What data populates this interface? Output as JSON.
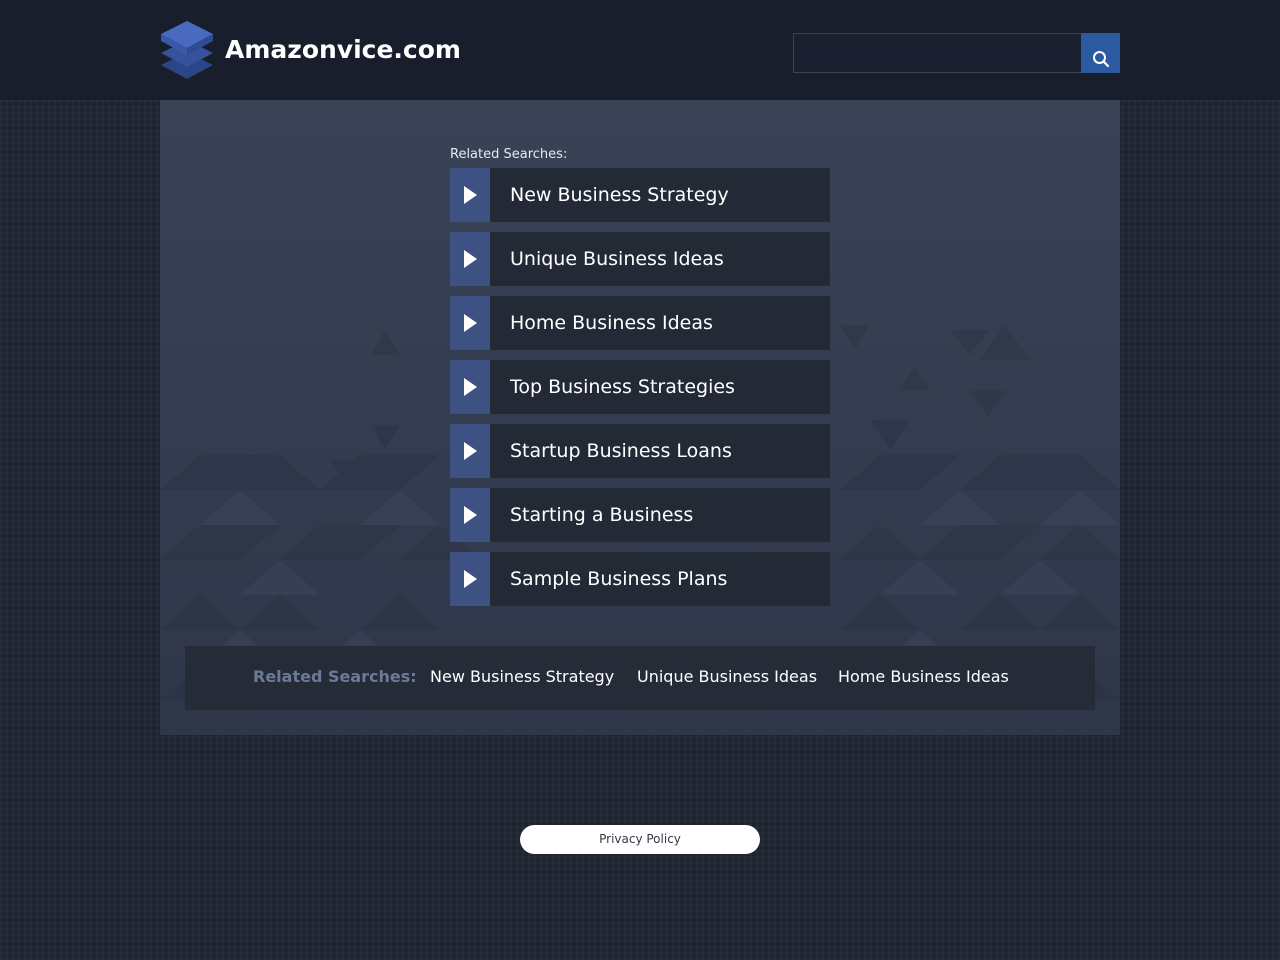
{
  "header": {
    "site_title": "Amazonvice.com",
    "logo_icon": "stacked-layers-icon",
    "search": {
      "placeholder": "",
      "value": "",
      "button_icon": "search-icon"
    }
  },
  "main": {
    "related_heading": "Related Searches:",
    "arrow_icon": "play-arrow-icon",
    "links": [
      {
        "label": "New Business Strategy"
      },
      {
        "label": "Unique Business Ideas"
      },
      {
        "label": "Home Business Ideas"
      },
      {
        "label": "Top Business Strategies"
      },
      {
        "label": "Startup Business Loans"
      },
      {
        "label": "Starting a Business"
      },
      {
        "label": "Sample Business Plans"
      }
    ]
  },
  "bottom_bar": {
    "label": "Related Searches:",
    "links": [
      {
        "label": "New Business Strategy"
      },
      {
        "label": "Unique Business Ideas"
      },
      {
        "label": "Home Business Ideas"
      }
    ]
  },
  "footer": {
    "privacy_label": "Privacy Policy"
  },
  "colors": {
    "page_background": "#1e2430",
    "header_background": "#181e2b",
    "panel_background": "#3a4256",
    "link_background": "#232935",
    "arrow_box": "#3d5283",
    "search_button": "#2c5aa0",
    "bottom_label": "#6c7a96",
    "text": "#ffffff"
  }
}
